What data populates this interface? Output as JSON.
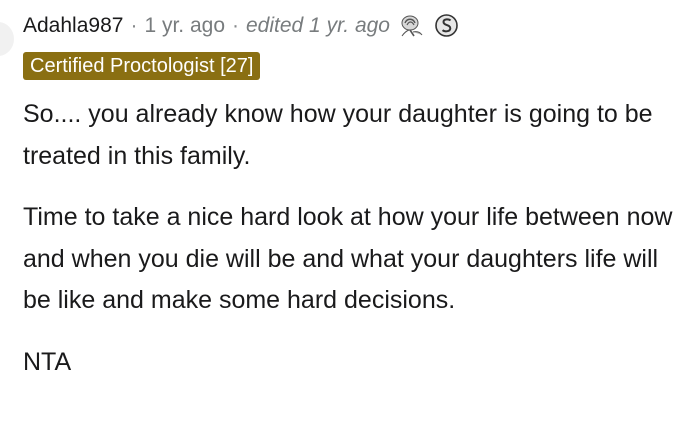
{
  "comment": {
    "username": "Adahla987",
    "separator": "·",
    "timestamp": "1 yr. ago",
    "edited": "edited 1 yr. ago",
    "flair": "Certified Proctologist [27]",
    "awards": [
      {
        "icon": "silver-rose-award-icon"
      },
      {
        "icon": "silver-s-award-icon"
      }
    ],
    "paragraphs": [
      "So.... you already know how your daughter is going to be treated in this family.",
      "Time to take a nice hard look at how your life between now and when you die will be and what your daughters life will be like and make some hard decisions.",
      "NTA"
    ],
    "colors": {
      "flair_background": "#8a6f12",
      "flair_text": "#ffffff",
      "meta_text": "#787c7e",
      "body_text": "#1a1a1b"
    }
  }
}
